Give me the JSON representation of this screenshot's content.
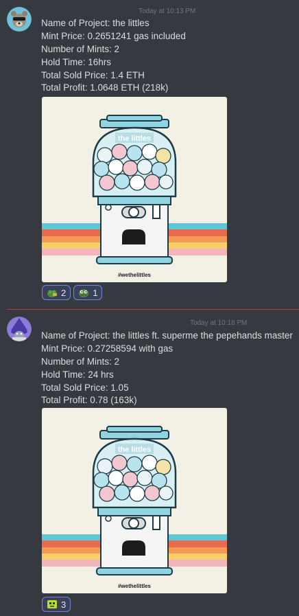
{
  "messages": [
    {
      "timestamp": "Today at 10:13 PM",
      "lines": [
        "Name of Project: the littles",
        "Mint Price: 0.2651241 gas included",
        "Number of Mints: 2",
        "Hold Time: 16hrs",
        "Total Sold Price: 1.4 ETH",
        "Total Profit: 1.0648 ETH (218k)"
      ],
      "image": {
        "brand": "the littles",
        "hashtag": "#wethelittles"
      },
      "reactions": [
        {
          "emoji": "frog-money-emoji",
          "count": "2"
        },
        {
          "emoji": "pepe-emoji",
          "count": "1"
        }
      ]
    },
    {
      "timestamp": "Today at 10:18 PM",
      "lines": [
        "Name of Project: the littles ft. superme the pepehands master",
        "Mint Price: 0.27258594 with gas",
        "Number of Mints: 2",
        "Hold Time: 24 hrs",
        "Total Sold Price: 1.05",
        "Total Profit: 0.78 (163k)"
      ],
      "image": {
        "brand": "the littles",
        "hashtag": "#wethelittles"
      },
      "reactions": [
        {
          "emoji": "green-block-emoji",
          "count": "3"
        }
      ]
    }
  ],
  "colors": {
    "background": "#36393f",
    "text": "#dcddde",
    "reaction_border": "#7289da",
    "divider": "#c8353b"
  }
}
